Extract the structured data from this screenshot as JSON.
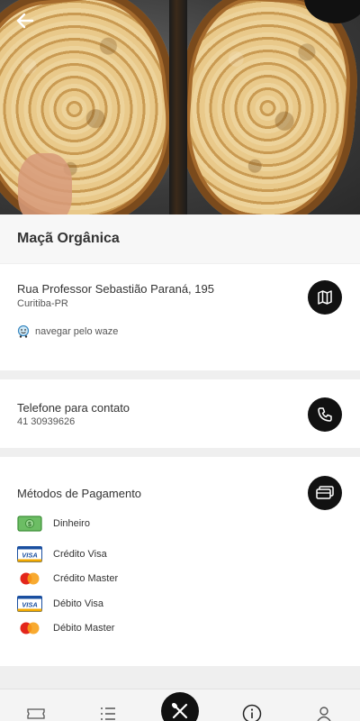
{
  "hero": {
    "image": "bread-loaf-photo",
    "back_icon": "arrow-left-icon"
  },
  "header": {
    "title": "Maçã Orgânica"
  },
  "address": {
    "street": "Rua Professor Sebastião Paraná, 195",
    "city": "Curitiba-PR",
    "waze_link": "navegar pelo waze",
    "map_icon": "map-icon"
  },
  "contact": {
    "label": "Telefone para contato",
    "phone": "41 30939626",
    "phone_icon": "phone-icon"
  },
  "payment": {
    "label": "Métodos de Pagamento",
    "icon": "payment-card-icon",
    "methods": [
      {
        "label": "Dinheiro",
        "icon": "cash-icon"
      },
      {
        "label": "Crédito Visa",
        "icon": "visa-icon"
      },
      {
        "label": "Crédito Master",
        "icon": "mastercard-icon"
      },
      {
        "label": "Débito Visa",
        "icon": "visa-icon"
      },
      {
        "label": "Débito Master",
        "icon": "mastercard-icon"
      }
    ]
  },
  "bottom_nav": {
    "items": [
      "ticket-icon",
      "list-icon",
      "cutlery-icon",
      "info-icon",
      "user-icon"
    ]
  },
  "colors": {
    "accent": "#111111",
    "background": "#efefef",
    "card": "#ffffff"
  }
}
